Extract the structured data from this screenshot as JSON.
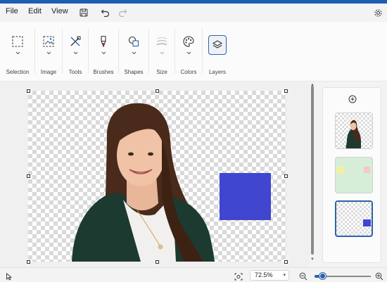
{
  "menu": {
    "file": "File",
    "edit": "Edit",
    "view": "View"
  },
  "menubar_icons": {
    "save": "save-icon",
    "undo": "undo-icon",
    "redo": "redo-icon",
    "settings": "gear-icon"
  },
  "toolbar": {
    "selection": "Selection",
    "image": "Image",
    "tools": "Tools",
    "brushes": "Brushes",
    "shapes": "Shapes",
    "size": "Size",
    "colors": "Colors",
    "layers": "Layers"
  },
  "canvas": {
    "shape_color": "#4146d0",
    "background": "transparent-checkerboard"
  },
  "layers_panel": {
    "add_icon": "add-layer-icon",
    "layers": [
      {
        "content": "portrait photo",
        "selected": false
      },
      {
        "content": "green background with yellow and pink squares",
        "selected": false
      },
      {
        "content": "blue square",
        "selected": true
      }
    ]
  },
  "status": {
    "zoom_value": "72.5%",
    "zoom_fraction": 0.15
  },
  "colors": {
    "accent": "#2f63a8",
    "title_bar": "#1a5fb4"
  }
}
